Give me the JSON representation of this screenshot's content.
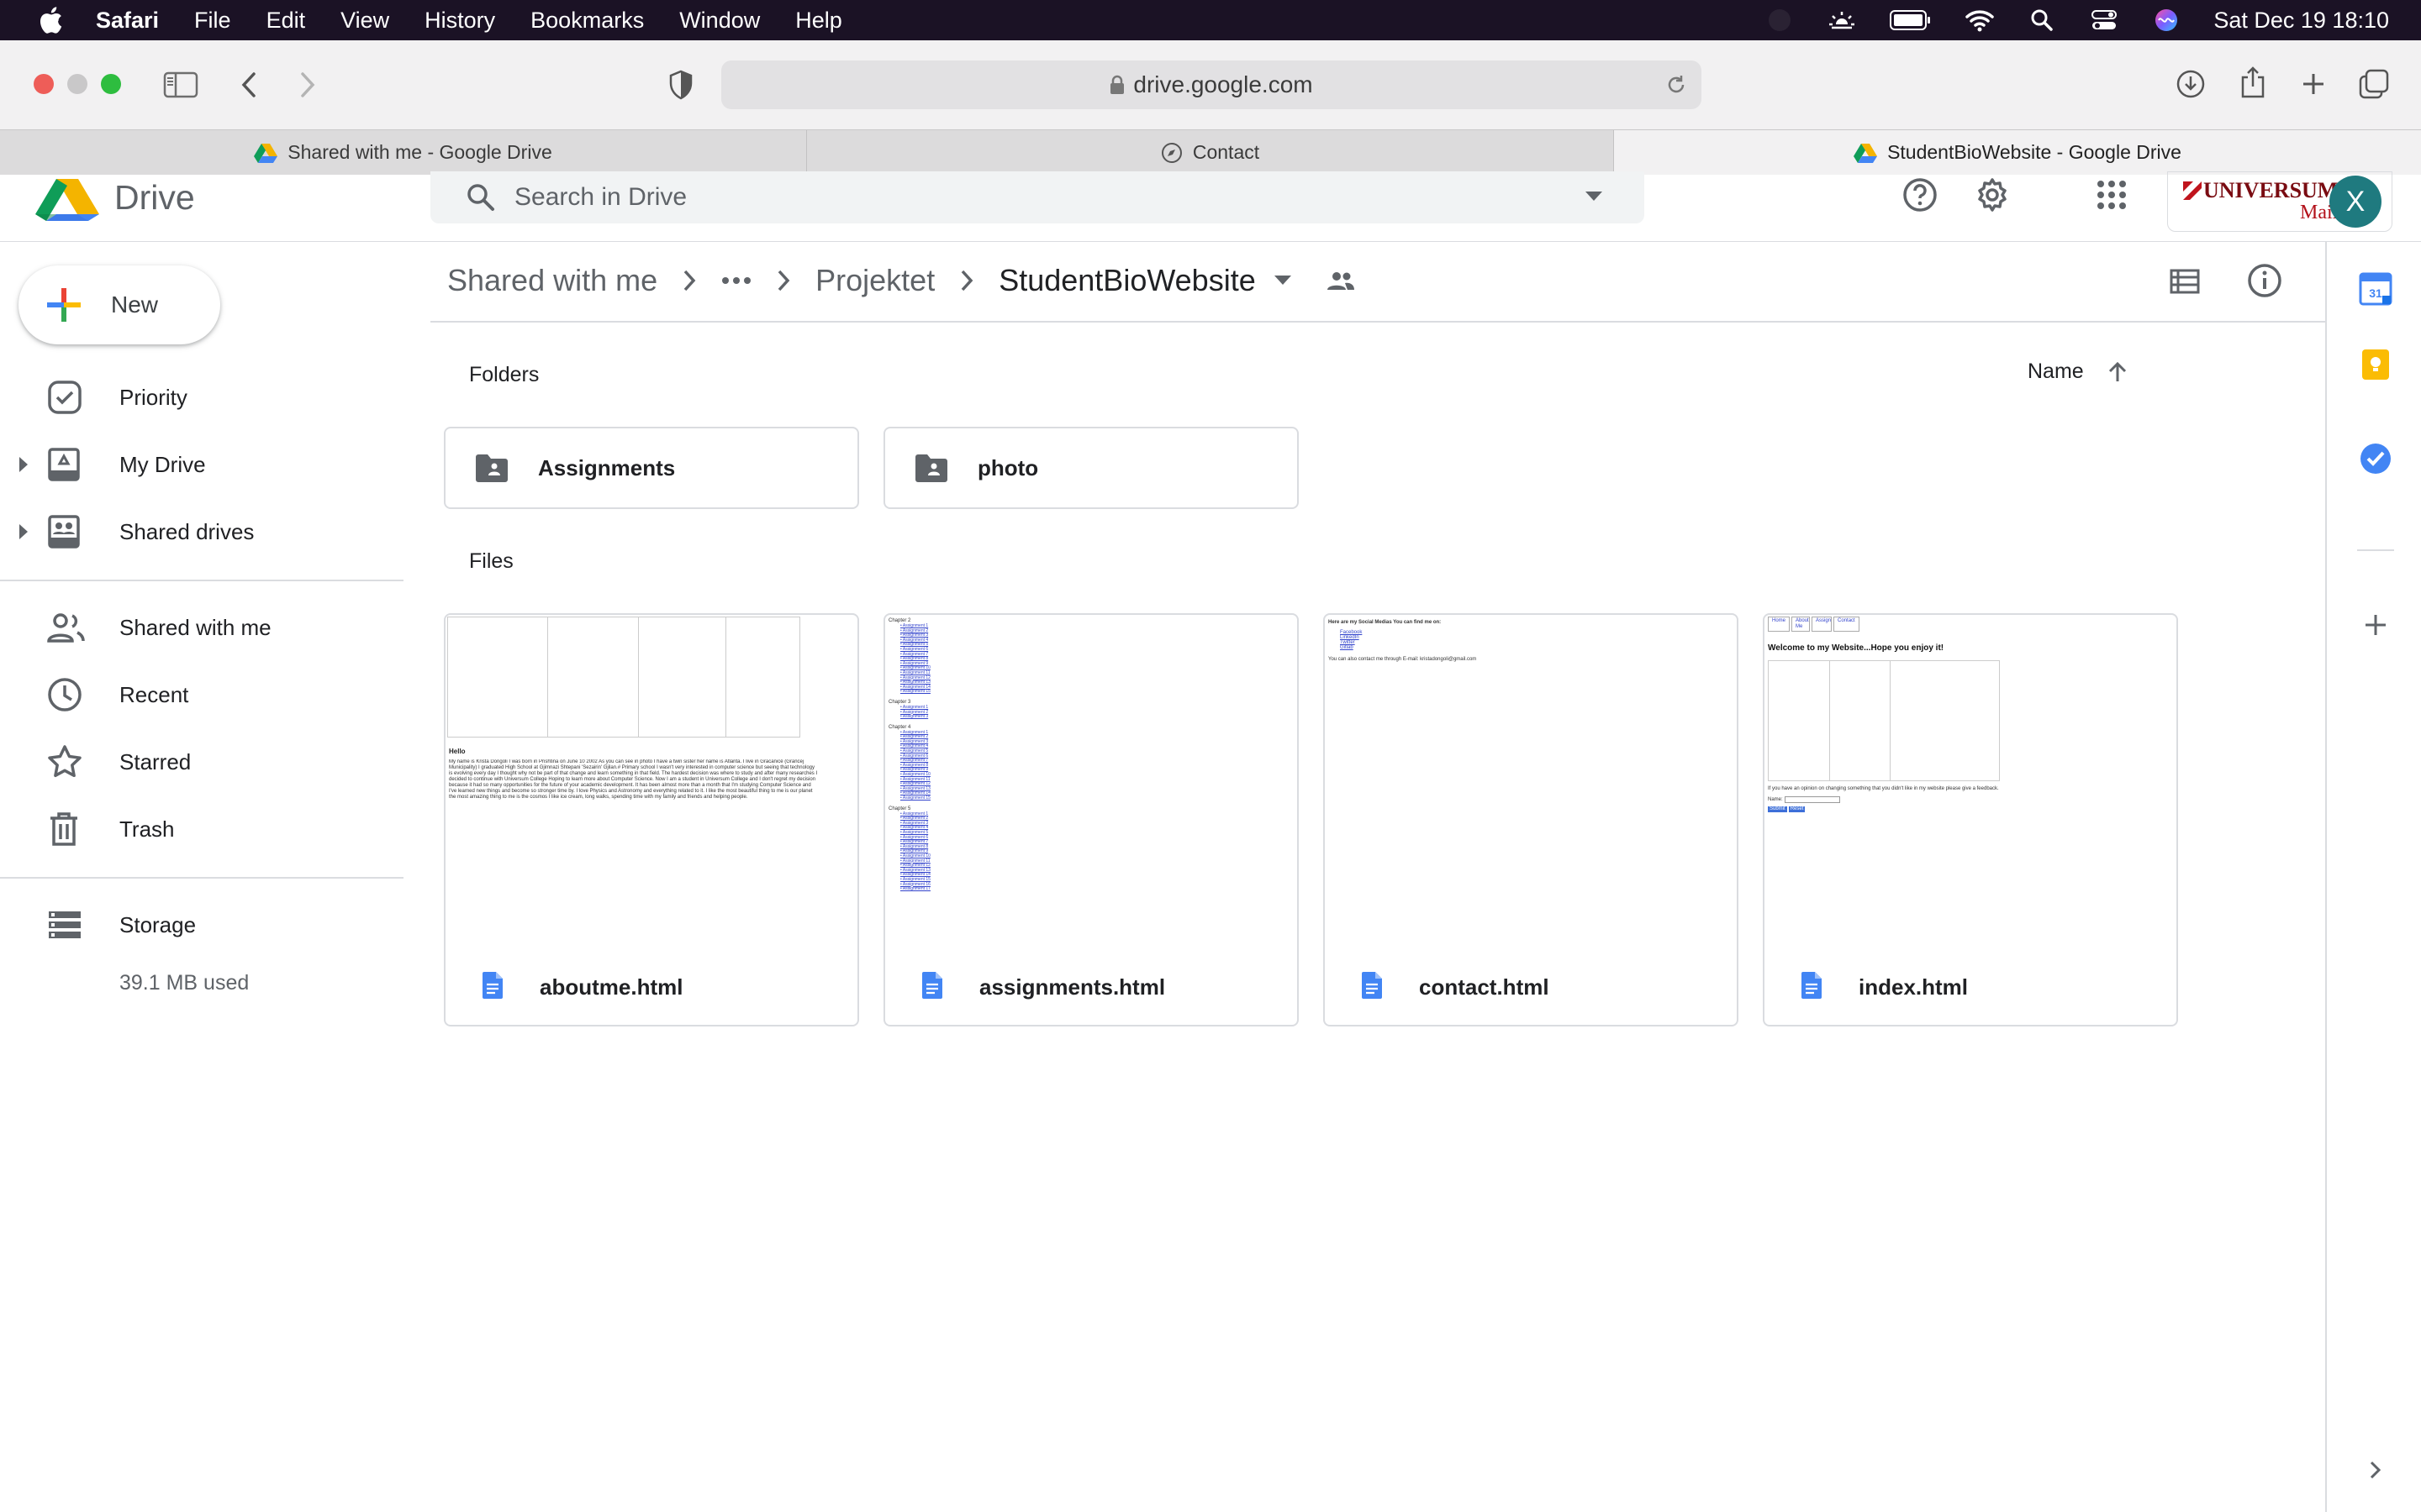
{
  "menubar": {
    "app": "Safari",
    "items": [
      "File",
      "Edit",
      "View",
      "History",
      "Bookmarks",
      "Window",
      "Help"
    ],
    "clock": "Sat Dec 19  18:10"
  },
  "browser": {
    "url": "drive.google.com",
    "tabs": [
      {
        "title": "Shared with me - Google Drive",
        "icon": "drive-icon",
        "active": false
      },
      {
        "title": "Contact",
        "icon": "compass-icon",
        "active": false
      },
      {
        "title": "StudentBioWebsite - Google Drive",
        "icon": "drive-icon",
        "active": true
      }
    ]
  },
  "header": {
    "logo_text": "Drive",
    "search_placeholder": "Search in Drive",
    "org_name": "UNIVERSUM",
    "org_sub": "Mail",
    "avatar_initial": "X"
  },
  "sidebar": {
    "new_label": "New",
    "items": [
      {
        "label": "Priority",
        "icon": "priority-icon"
      },
      {
        "label": "My Drive",
        "icon": "my-drive-icon"
      },
      {
        "label": "Shared drives",
        "icon": "shared-drives-icon"
      },
      {
        "label": "Shared with me",
        "icon": "shared-with-me-icon"
      },
      {
        "label": "Recent",
        "icon": "clock-icon"
      },
      {
        "label": "Starred",
        "icon": "star-icon"
      },
      {
        "label": "Trash",
        "icon": "trash-icon"
      },
      {
        "label": "Storage",
        "icon": "storage-icon"
      }
    ],
    "storage_used": "39.1 MB used"
  },
  "breadcrumb": {
    "root": "Shared with me",
    "middle": "Projektet",
    "current": "StudentBioWebsite"
  },
  "main": {
    "folders_label": "Folders",
    "files_label": "Files",
    "sort_label": "Name",
    "folders": [
      {
        "name": "Assignments"
      },
      {
        "name": "photo"
      }
    ],
    "files": [
      {
        "name": "aboutme.html"
      },
      {
        "name": "assignments.html"
      },
      {
        "name": "contact.html"
      },
      {
        "name": "index.html"
      }
    ]
  },
  "thumbnails": {
    "aboutme": {
      "heading": "Hello",
      "body": "My name is Krista Dongoli I was born in Prishtina on June 10 2002 As you can see in photo I have a twin sister her name is Atlanta. I live in Gracanicë (Grancej Municipality) I graduated High School at Gjimnazi Shtepani 'Sezairin' Gjilan.# Primary school I wasn't very interested in computer science but seeing that technology is evolving every day I thought why not be part of that change and learn something in that field. The hardest decision was where to study and after many researches I decided to continue with Universum College Hoping to learn more about Computer Science. Now I am a student in Universum College and I don't regret my decision because it had so many opportunities for the future of your academic development. It has been almost more than a month that I'm studying Computer Science and I've learned new things and become so stronger time by. I love Physics and Astronomy and everything related to it. I like the most beautiful thing to me is our planet the most amazing thing to me is the cosmos I like ice cream, long walks, spending time with my family and friends and helping people."
    },
    "assignments": {
      "chapters": [
        "Chapter 2",
        "Chapter 3",
        "Chapter 4",
        "Chapter 5"
      ],
      "item_label": "Assignment"
    },
    "contact": {
      "heading": "Here are my Social Medias You can find me on:",
      "links": [
        "Facebook",
        "LinkedIn",
        "Twitter",
        "Gitlab"
      ],
      "footer": "You can also contact me through E-mail: kristadongoli@gmail.com"
    },
    "index": {
      "nav": [
        "Home",
        "About Me",
        "Assignments",
        "Contact"
      ],
      "heading": "Welcome to my Website...Hope you enjoy it!",
      "note": "If you have an opinion on changing something that you didn't like in my website please give a feedback.",
      "name_label": "Name:",
      "buttons": [
        "Submit",
        "Reset"
      ]
    }
  },
  "colors": {
    "drive_blue": "#4285f4",
    "drive_green": "#0f9d58",
    "drive_yellow": "#f4b400",
    "drive_red": "#db4437",
    "doc_blue": "#4285f4",
    "avatar": "#1f7a7f",
    "menubar": "#1b1225"
  }
}
